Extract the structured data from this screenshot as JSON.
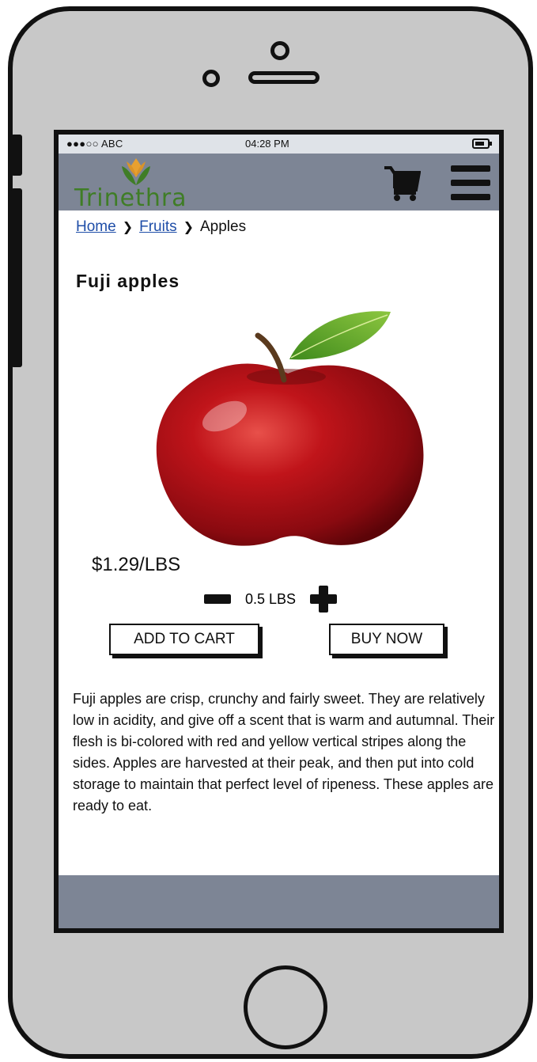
{
  "status_bar": {
    "carrier": "●●●○○ ABC",
    "time": "04:28 PM",
    "battery_icon": "battery-icon"
  },
  "header": {
    "logo_text": "Trinethra",
    "cart_icon": "cart-icon",
    "menu_icon": "hamburger-menu-icon"
  },
  "breadcrumb": {
    "items": [
      "Home",
      "Fruits",
      "Apples"
    ],
    "separator": "❯"
  },
  "product": {
    "title": "Fuji apples",
    "image": "red-apple-image",
    "price": "$1.29/LBS",
    "quantity": "0.5 LBS",
    "add_to_cart_label": "ADD TO CART",
    "buy_now_label": "BUY NOW",
    "description": "Fuji apples are crisp, crunchy and fairly sweet. They are relatively low in acidity, and give off a scent that is warm and autumnal. Their flesh is bi-colored with red and yellow vertical stripes along the sides. Apples are harvested at their peak, and then put into cold storage to maintain that perfect level of ripeness. These apples are ready to eat."
  },
  "colors": {
    "header_bg": "#7d8595",
    "status_bg": "#dfe3e8",
    "phone_body": "#c8c8c8",
    "link": "#1f4ea8",
    "logo_green": "#3f7d26",
    "logo_orange": "#e8a030"
  }
}
